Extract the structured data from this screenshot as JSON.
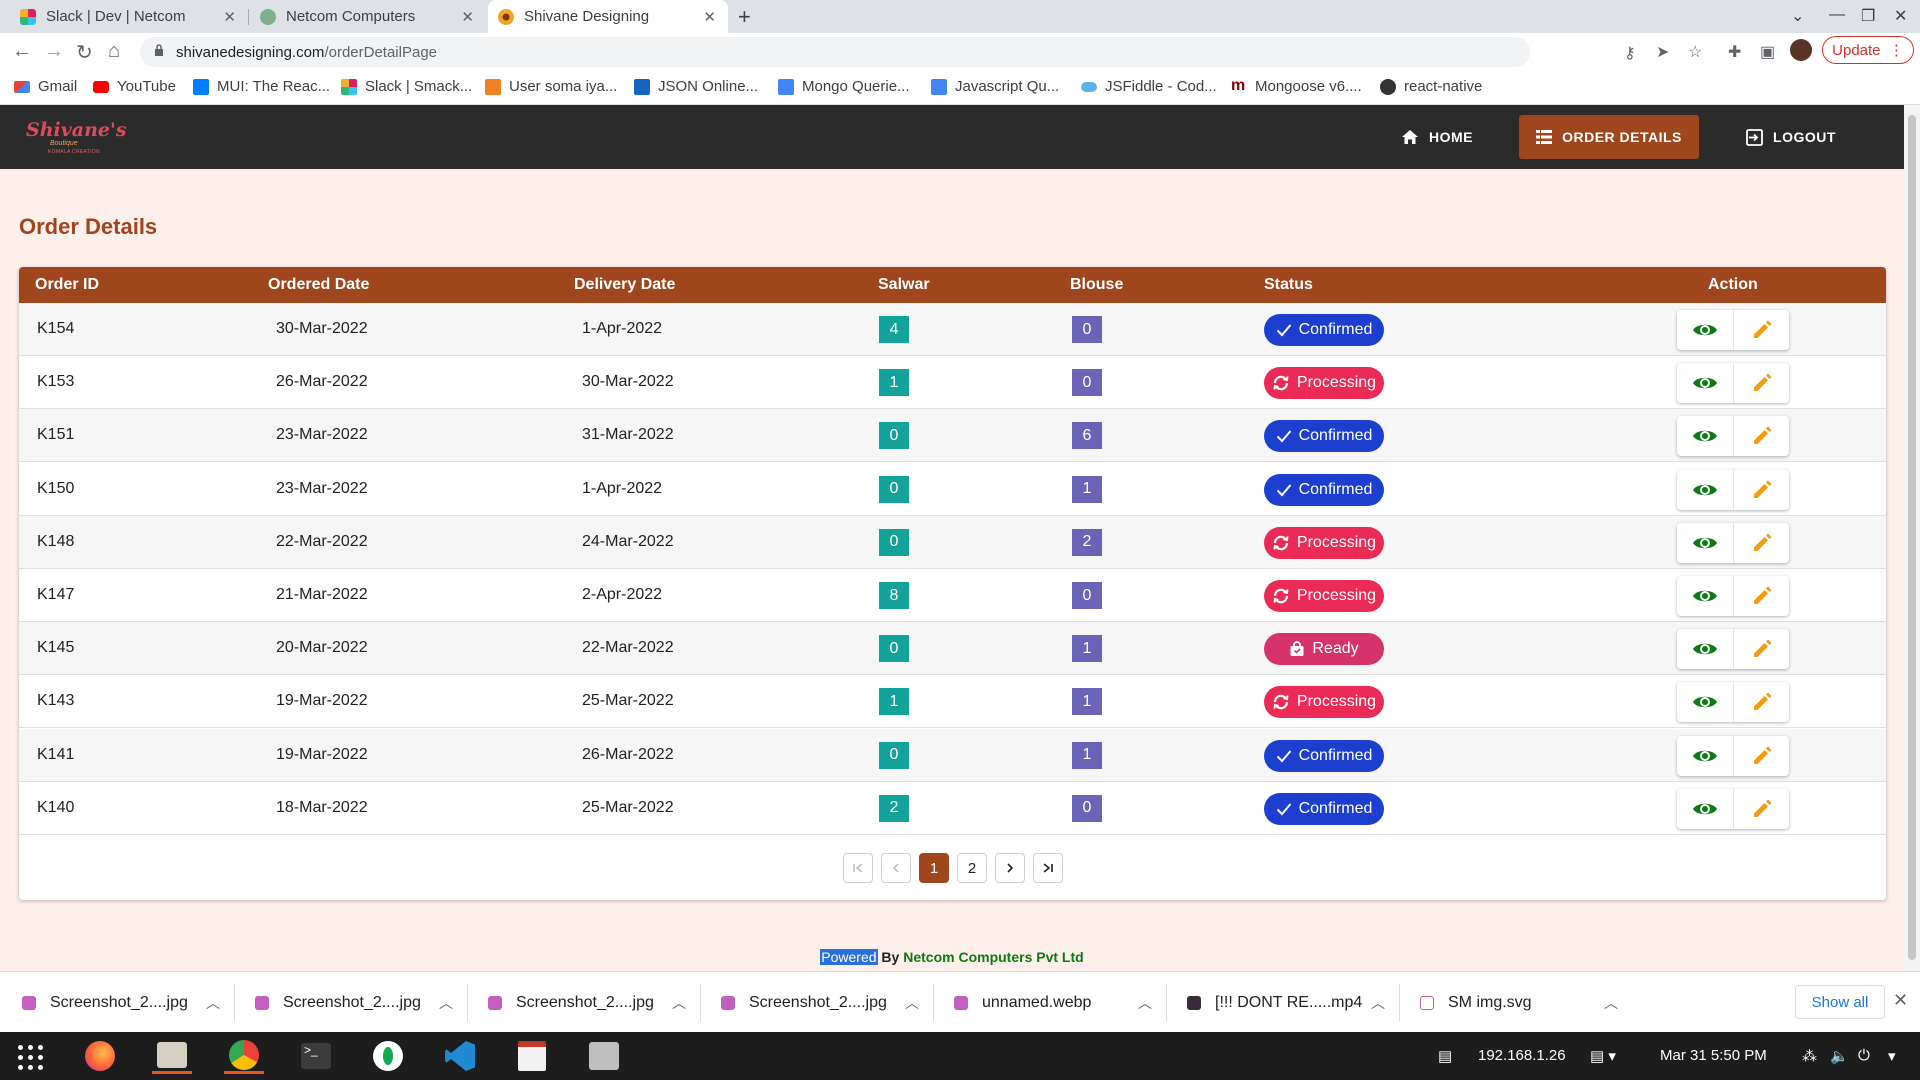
{
  "browser": {
    "tabs": [
      {
        "title": "Slack | Dev | Netcom",
        "active": false
      },
      {
        "title": "Netcom Computers",
        "active": false
      },
      {
        "title": "Shivane Designing",
        "active": true
      }
    ],
    "url_domain": "shivanedesigning.com",
    "url_path": "/orderDetailPage",
    "update_label": "Update",
    "bookmarks": [
      "Gmail",
      "YouTube",
      "MUI: The Reac...",
      "Slack | Smack...",
      "User soma iya...",
      "JSON Online...",
      "Mongo Querie...",
      "Javascript Qu...",
      "JSFiddle - Cod...",
      "Mongoose v6....",
      "react-native"
    ]
  },
  "nav": {
    "brand": {
      "line1": "Shivane's",
      "line2": "Boutique",
      "line3": "KOMALA CREATION"
    },
    "home": "HOME",
    "order_details": "ORDER DETAILS",
    "logout": "LOGOUT"
  },
  "page": {
    "title": "Order Details"
  },
  "table": {
    "headers": {
      "order_id": "Order ID",
      "ordered_date": "Ordered Date",
      "delivery_date": "Delivery Date",
      "salwar": "Salwar",
      "blouse": "Blouse",
      "status": "Status",
      "action": "Action"
    },
    "rows": [
      {
        "id": "K154",
        "ordered": "30-Mar-2022",
        "delivery": "1-Apr-2022",
        "salwar": "4",
        "blouse": "0",
        "status": "Confirmed"
      },
      {
        "id": "K153",
        "ordered": "26-Mar-2022",
        "delivery": "30-Mar-2022",
        "salwar": "1",
        "blouse": "0",
        "status": "Processing"
      },
      {
        "id": "K151",
        "ordered": "23-Mar-2022",
        "delivery": "31-Mar-2022",
        "salwar": "0",
        "blouse": "6",
        "status": "Confirmed"
      },
      {
        "id": "K150",
        "ordered": "23-Mar-2022",
        "delivery": "1-Apr-2022",
        "salwar": "0",
        "blouse": "1",
        "status": "Confirmed"
      },
      {
        "id": "K148",
        "ordered": "22-Mar-2022",
        "delivery": "24-Mar-2022",
        "salwar": "0",
        "blouse": "2",
        "status": "Processing"
      },
      {
        "id": "K147",
        "ordered": "21-Mar-2022",
        "delivery": "2-Apr-2022",
        "salwar": "8",
        "blouse": "0",
        "status": "Processing"
      },
      {
        "id": "K145",
        "ordered": "20-Mar-2022",
        "delivery": "22-Mar-2022",
        "salwar": "0",
        "blouse": "1",
        "status": "Ready"
      },
      {
        "id": "K143",
        "ordered": "19-Mar-2022",
        "delivery": "25-Mar-2022",
        "salwar": "1",
        "blouse": "1",
        "status": "Processing"
      },
      {
        "id": "K141",
        "ordered": "19-Mar-2022",
        "delivery": "26-Mar-2022",
        "salwar": "0",
        "blouse": "1",
        "status": "Confirmed"
      },
      {
        "id": "K140",
        "ordered": "18-Mar-2022",
        "delivery": "25-Mar-2022",
        "salwar": "2",
        "blouse": "0",
        "status": "Confirmed"
      }
    ]
  },
  "pagination": {
    "pages": [
      "1",
      "2"
    ],
    "current": "1"
  },
  "footer": {
    "highlight": "Powered",
    "by": " By ",
    "company": "Netcom Computers Pvt Ltd"
  },
  "downloads": {
    "items": [
      "Screenshot_2....jpg",
      "Screenshot_2....jpg",
      "Screenshot_2....jpg",
      "Screenshot_2....jpg",
      "unnamed.webp",
      "[!!! DONT RE.....mp4",
      "SM img.svg"
    ],
    "show_all": "Show all"
  },
  "taskbar": {
    "ip": "192.168.1.26",
    "datetime": "Mar 31  5:50 PM"
  },
  "colors": {
    "brand": "#a0461e",
    "navbar": "#2b2b2b",
    "confirmed": "#1d3fcf",
    "processing": "#ea2b55",
    "ready": "#d6336c",
    "salwar_chip": "#14a39a",
    "blouse_chip": "#6b63b5",
    "view_icon": "#0e7a14",
    "edit_icon": "#f39c12"
  }
}
